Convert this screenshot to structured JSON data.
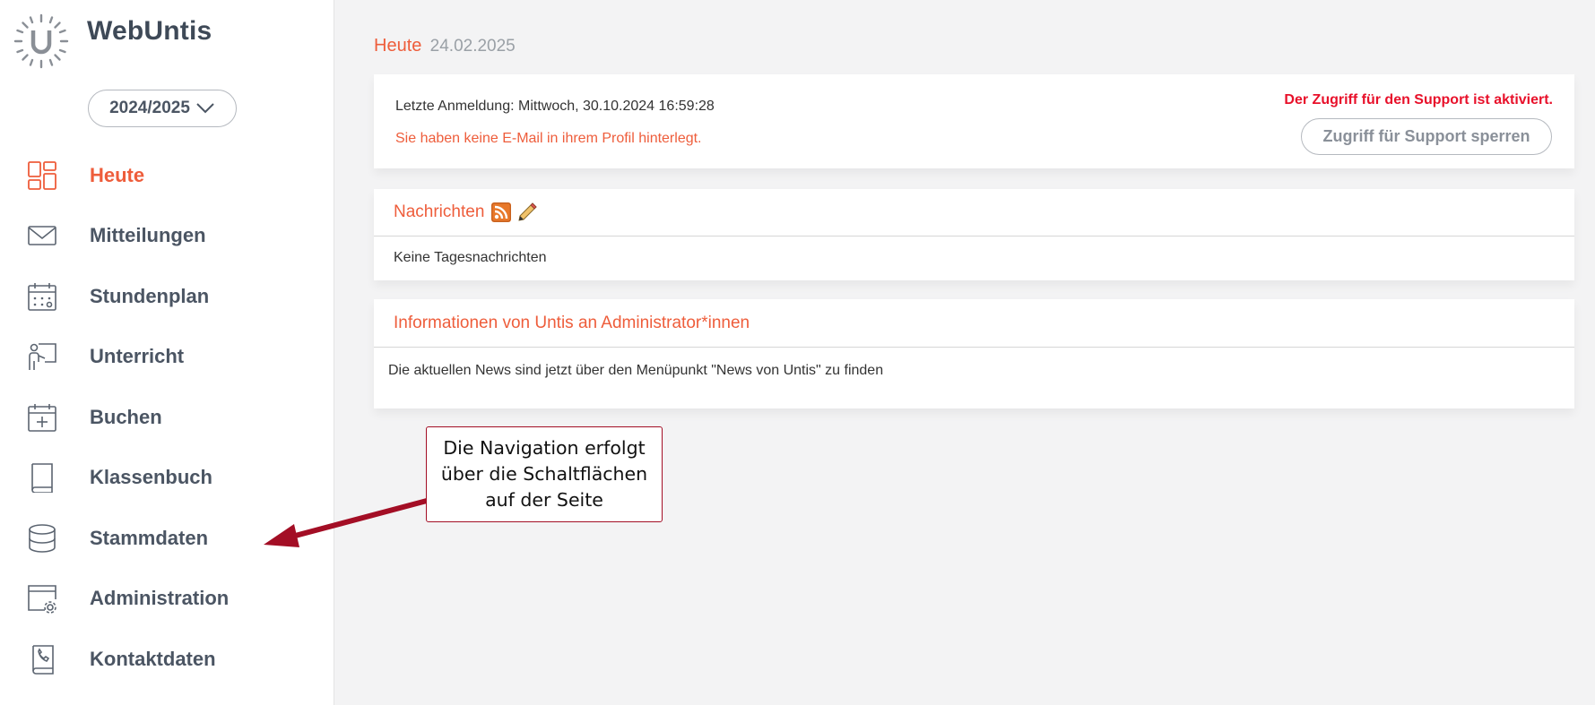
{
  "app": {
    "title": "WebUntis",
    "accent_color": "#ee5d3b",
    "logo_icon": "untis-sun-logo"
  },
  "school_year": {
    "selected": "2024/2025",
    "icon": "chevron-down-icon"
  },
  "sidebar": {
    "items": [
      {
        "label": "Heute",
        "icon": "dashboard-icon",
        "active": true
      },
      {
        "label": "Mitteilungen",
        "icon": "envelope-icon",
        "active": false
      },
      {
        "label": "Stundenplan",
        "icon": "calendar-icon",
        "active": false
      },
      {
        "label": "Unterricht",
        "icon": "teacher-board-icon",
        "active": false
      },
      {
        "label": "Buchen",
        "icon": "calendar-add-icon",
        "active": false
      },
      {
        "label": "Klassenbuch",
        "icon": "book-icon",
        "active": false
      },
      {
        "label": "Stammdaten",
        "icon": "database-icon",
        "active": false
      },
      {
        "label": "Administration",
        "icon": "admin-settings-icon",
        "active": false
      },
      {
        "label": "Kontaktdaten",
        "icon": "contact-book-icon",
        "active": false
      }
    ]
  },
  "header": {
    "title": "Heute",
    "date": "24.02.2025"
  },
  "login_card": {
    "last_login": "Letzte Anmeldung: Mittwoch, 30.10.2024 16:59:28",
    "email_warning": "Sie haben keine E-Mail in ihrem Profil hinterlegt.",
    "support_status": "Der Zugriff für den Support ist aktiviert.",
    "support_button": "Zugriff für Support sperren"
  },
  "news_card": {
    "title": "Nachrichten",
    "body": "Keine Tagesnachrichten",
    "icons": [
      "rss-icon",
      "pencil-icon"
    ]
  },
  "info_card": {
    "title": "Informationen von Untis an Administrator*innen",
    "body": "Die aktuellen News sind jetzt über den Menüpunkt \"News von Untis\" zu finden"
  },
  "annotation": {
    "text": "Die Navigation erfolgt über die Schaltflächen auf der Seite",
    "color": "#a30e25"
  }
}
